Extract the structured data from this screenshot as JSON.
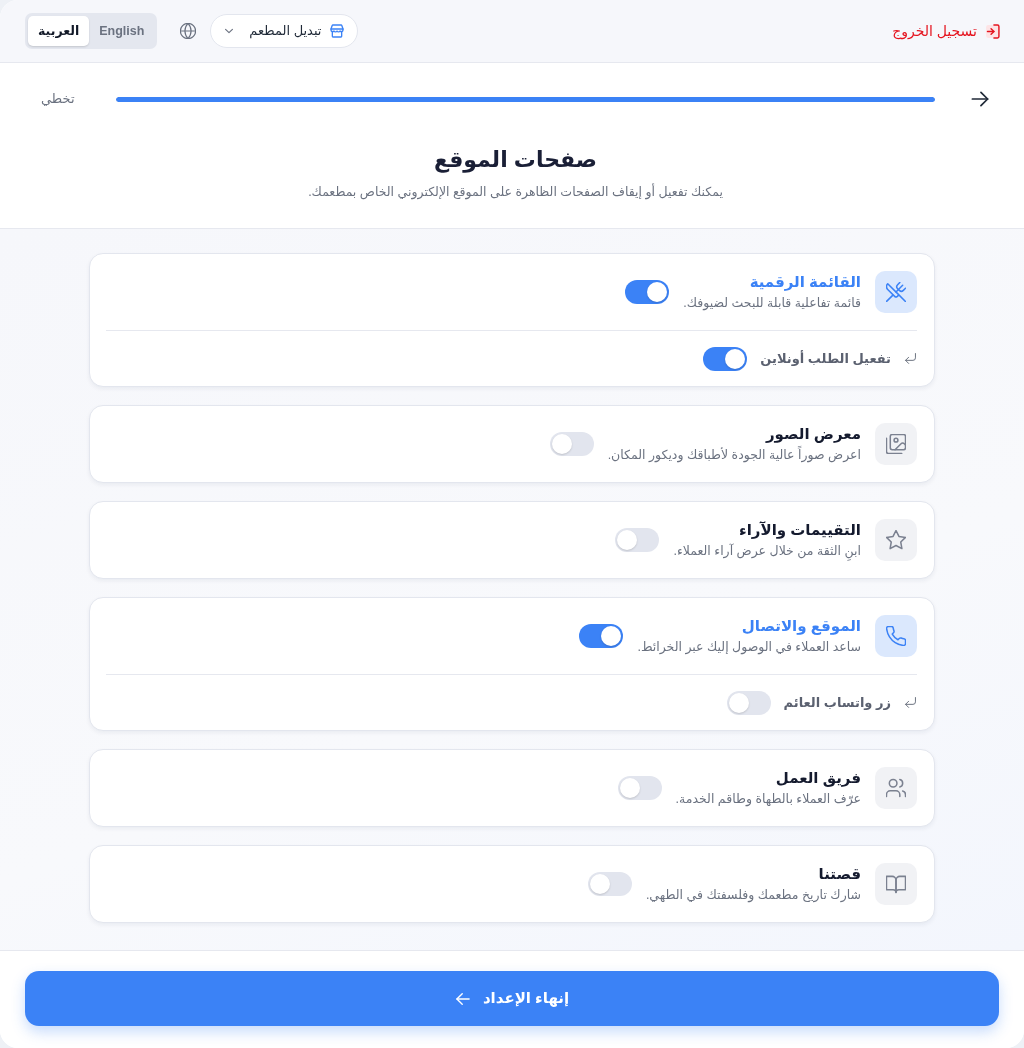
{
  "header": {
    "logout": "تسجيل الخروج",
    "restaurant_switcher": "تبديل المطعم",
    "languages": [
      {
        "label": "English",
        "selected": false
      },
      {
        "label": "العربية",
        "selected": true
      }
    ]
  },
  "progress": {
    "level": 1,
    "skip": "تخطي"
  },
  "intro": {
    "title": "صفحات الموقع",
    "subtitle": "يمكنك تفعيل أو إيقاف الصفحات الظاهرة على الموقع الإلكتروني الخاص بمطعمك."
  },
  "pages": [
    {
      "kind": "menu",
      "title": "القائمة الرقمية",
      "description": "قائمة تفاعلية قابلة للبحث لضيوفك.",
      "on": true,
      "options": [
        {
          "label": "تفعيل الطلب أونلاين",
          "on": true
        }
      ]
    },
    {
      "kind": "gallery",
      "title": "معرض الصور",
      "description": "اعرض صوراً عالية الجودة لأطباقك وديكور المكان.",
      "on": false
    },
    {
      "kind": "reviews",
      "title": "التقييمات والآراء",
      "description": "ابنِ الثقة من خلال عرض آراء العملاء.",
      "on": false
    },
    {
      "kind": "contact",
      "title": "الموقع والاتصال",
      "description": "ساعد العملاء في الوصول إليك عبر الخرائط.",
      "on": true,
      "options": [
        {
          "label": "زر واتساب العائم",
          "on": false
        }
      ]
    },
    {
      "kind": "team",
      "title": "فريق العمل",
      "description": "عرّف العملاء بالطهاة وطاقم الخدمة.",
      "on": false
    },
    {
      "kind": "story",
      "title": "قصتنا",
      "description": "شارك تاريخ مطعمك وفلسفتك في الطهي.",
      "on": false
    }
  ],
  "finish_button": "إنهاء الإعداد"
}
